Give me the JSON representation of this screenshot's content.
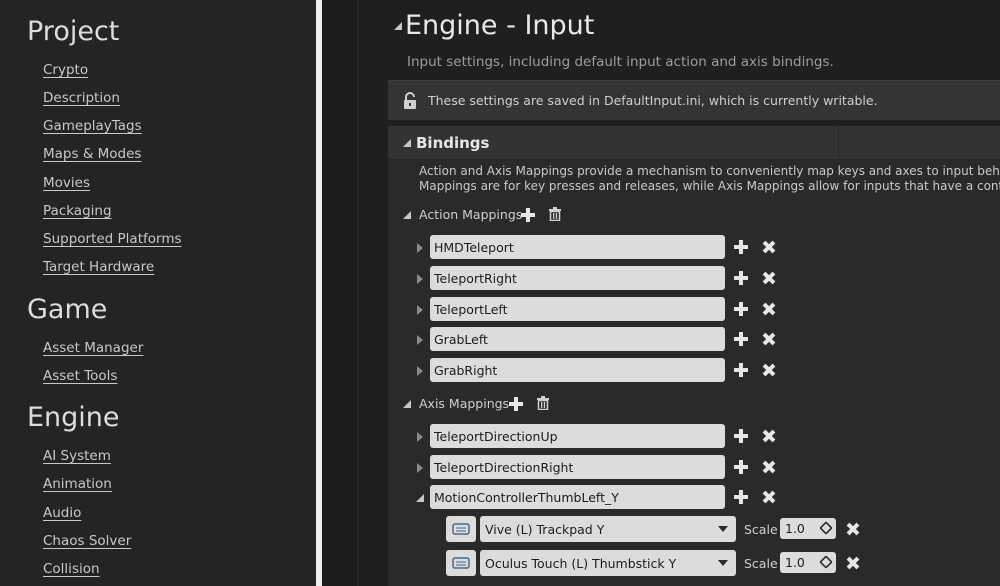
{
  "sidebar": {
    "sections": [
      {
        "title": "Project",
        "links": [
          "Crypto",
          "Description",
          "GameplayTags",
          "Maps & Modes",
          "Movies",
          "Packaging",
          "Supported Platforms",
          "Target Hardware"
        ]
      },
      {
        "title": "Game",
        "links": [
          "Asset Manager",
          "Asset Tools"
        ]
      },
      {
        "title": "Engine",
        "links": [
          "AI System",
          "Animation",
          "Audio",
          "Chaos Solver",
          "Collision"
        ]
      }
    ]
  },
  "main": {
    "title": "Engine - Input",
    "subtitle": "Input settings, including default input action and axis bindings.",
    "notice": "These settings are saved in DefaultInput.ini, which is currently writable.",
    "bindings": {
      "title": "Bindings",
      "description_line1": "Action and Axis Mappings provide a mechanism to conveniently map keys and axes to input behaviors b",
      "description_line2": "Mappings are for key presses and releases, while Axis Mappings allow for inputs that have a continuous",
      "action_mappings_label": "Action Mappings",
      "action_mappings": [
        "HMDTeleport",
        "TeleportRight",
        "TeleportLeft",
        "GrabLeft",
        "GrabRight"
      ],
      "axis_mappings_label": "Axis Mappings",
      "axis_mappings": [
        "TeleportDirectionUp",
        "TeleportDirectionRight",
        "MotionControllerThumbLeft_Y"
      ],
      "axis_keys": [
        {
          "key": "Vive (L) Trackpad Y",
          "scale_label": "Scale",
          "scale": "1.0"
        },
        {
          "key": "Oculus Touch (L) Thumbstick Y",
          "scale_label": "Scale",
          "scale": "1.0"
        }
      ]
    }
  },
  "icons": {
    "lock": "lock-icon",
    "add": "plus-icon",
    "remove": "x-icon",
    "trash": "trash-icon",
    "gamepad": "gamepad-icon"
  },
  "colors": {
    "background": "#1a1a1a",
    "sidebar": "#242424",
    "panel": "#2a2a2a",
    "field": "#dcdcdc"
  }
}
